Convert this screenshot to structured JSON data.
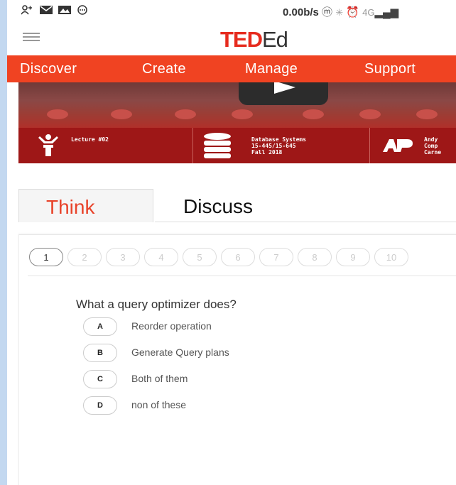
{
  "status_bar": {
    "speed": "0.00b/s",
    "network": "4G",
    "icons": [
      "person-icon",
      "mail-icon",
      "image-icon",
      "message-icon",
      "hotspot-icon",
      "bluetooth-icon",
      "alarm-icon",
      "signal-icon"
    ]
  },
  "header": {
    "logo_ted": "TED",
    "logo_ed": "Ed"
  },
  "nav": {
    "items": [
      "Discover",
      "Create",
      "Manage",
      "Support"
    ]
  },
  "video": {
    "lecture_label": "Lecture #02",
    "course_line1": "Database Systems",
    "course_line2": "15-445/15-645",
    "course_line3": "Fall 2018",
    "author_line1": "Andy",
    "author_line2": "Comp",
    "author_line3": "Carne"
  },
  "tabs": {
    "think": "Think",
    "discuss": "Discuss"
  },
  "quiz": {
    "question_numbers": [
      "1",
      "2",
      "3",
      "4",
      "5",
      "6",
      "7",
      "8",
      "9",
      "10"
    ],
    "active_question": "1",
    "question": "What a query optimizer does?",
    "options": [
      {
        "letter": "A",
        "text": "Reorder operation"
      },
      {
        "letter": "B",
        "text": "Generate Query plans"
      },
      {
        "letter": "C",
        "text": "Both of them"
      },
      {
        "letter": "D",
        "text": "non of these"
      }
    ]
  },
  "colors": {
    "ted_red": "#e62b1e",
    "nav_orange": "#f04322",
    "info_red": "#9e1717",
    "frame_blue": "#c3d8f0"
  }
}
